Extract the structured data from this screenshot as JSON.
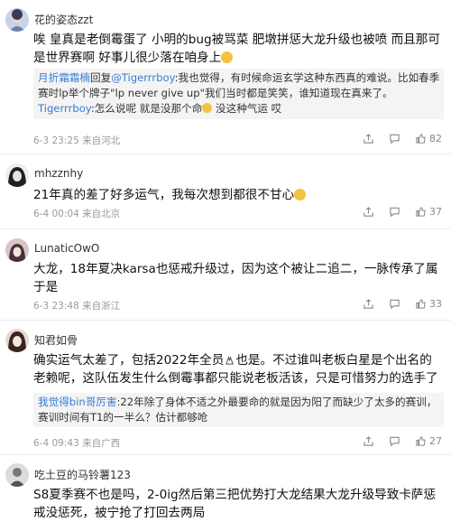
{
  "comments": [
    {
      "username": "花的姿态zzt",
      "text_1": "唉 皇真是老倒霉蛋了 小明的bug被骂菜 肥墩拼惩大龙升级也被喷 而且那可是世界赛啊 好事儿很少落在咱身上",
      "reply_1_user": "月折霜霜楠",
      "reply_1_mid": "回复",
      "reply_1_target": "@Tigerrrboy",
      "reply_1_text": ":我也觉得，有时候命运玄学这种东西真的难说。比如春季赛时lp举个牌子\"lp never give up\"我们当时都是笑笑，谁知道现在真来了。",
      "reply_2_user": "Tigerrrboy",
      "reply_2_text": ":怎么说呢 就是没那个命",
      "reply_2_text_b": " 没这种气运 哎",
      "date": "6-3 23:25",
      "location": "来自河北",
      "likes": "82"
    },
    {
      "username": "mhzznhy",
      "text_1": "21年真的差了好多运气，我每次想到都很不甘心",
      "date": "6-4 00:04",
      "location": "来自北京",
      "likes": "37"
    },
    {
      "username": "LunaticOwO",
      "text_1": "大龙，18年夏决karsa也惩戒升级过，因为这个被让二追二，一脉传承了属于是",
      "date": "6-3 23:48",
      "location": "来自浙江",
      "likes": "33"
    },
    {
      "username": "知君如骨",
      "text_1": "确实运气太差了，包括2022年全员",
      "text_1b": "也是。不过谁叫老板白星是个出名的老赖呢，这队伍发生什么倒霉事都只能说老板活该，只是可惜努力的选手了",
      "reply_1_user": "我觉得bin哥厉害",
      "reply_1_text": ":22年除了身体不适之外最要命的就是因为阳了而缺少了太多的赛训，赛训时间有T1的一半么？估计都够呛",
      "date": "6-4 09:43",
      "location": "来自广西",
      "likes": "27"
    },
    {
      "username": "吃土豆的马铃薯123",
      "text_1": "S8夏季赛不也是吗，2-0ig然后第三把优势打大龙结果大龙升级导致卡萨惩戒没惩死，被宁抢了打回去两局"
    }
  ],
  "icons": {
    "share": "share-icon",
    "reply": "comment-icon",
    "like": "like-icon"
  },
  "colors": {
    "link": "#3a7bd5",
    "meta": "#9a9a9a",
    "reply_bg": "#f4f4f4"
  }
}
